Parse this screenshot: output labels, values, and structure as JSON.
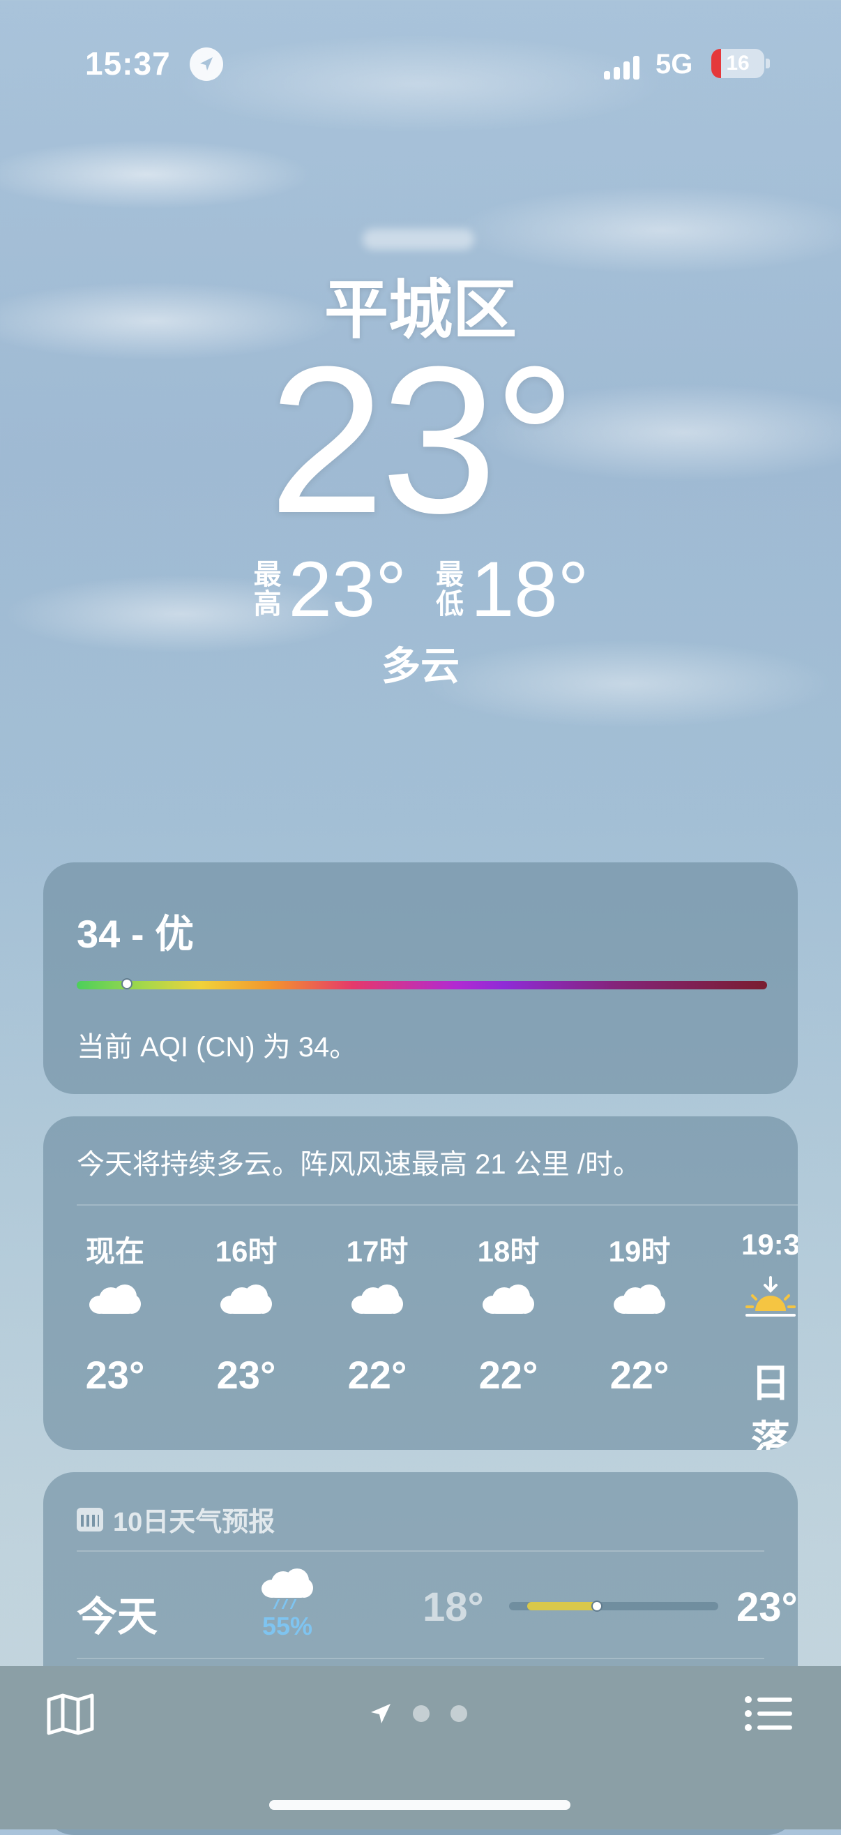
{
  "status_bar": {
    "time": "15:37",
    "network": "5G",
    "battery": "16"
  },
  "location": {
    "city": "平城区"
  },
  "current": {
    "temperature": "23°",
    "high_label": "最高",
    "high": "23°",
    "low_label": "最低",
    "low": "18°",
    "condition": "多云"
  },
  "aqi": {
    "title": "34 - 优",
    "level": 34,
    "description": "当前 AQI (CN) 为 34。"
  },
  "hourly": {
    "summary": "今天将持续多云。阵风风速最高 21 公里 /时。",
    "items": [
      {
        "time": "现在",
        "icon": "cloud-icon",
        "temp": "23°"
      },
      {
        "time": "16时",
        "icon": "cloud-icon",
        "temp": "23°"
      },
      {
        "time": "17时",
        "icon": "cloud-icon",
        "temp": "22°"
      },
      {
        "time": "18时",
        "icon": "cloud-icon",
        "temp": "22°"
      },
      {
        "time": "19时",
        "icon": "cloud-icon",
        "temp": "22°"
      },
      {
        "time": "19:3",
        "icon": "sunset-icon",
        "temp": "日落"
      }
    ]
  },
  "daily": {
    "header": "10日天气预报",
    "rows": [
      {
        "day": "今天",
        "icon": "rain-cloud-icon",
        "precip": "55%",
        "low": "18°",
        "high": "23°"
      }
    ]
  },
  "colors": {
    "precip": "#7fc4f0",
    "range_bar": "#d9c84a",
    "sunset": "#f5c542"
  }
}
